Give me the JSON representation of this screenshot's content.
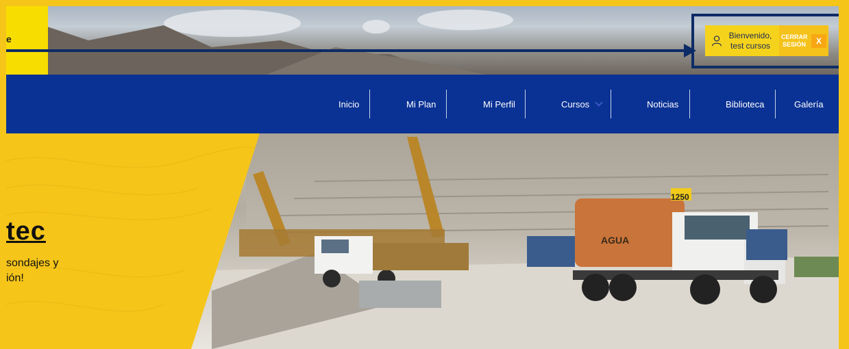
{
  "header": {
    "user_welcome_line1": "Bienvenido,",
    "user_welcome_line2": "test cursos",
    "logout_line1": "CERRAR",
    "logout_line2": "SESIÓN",
    "logout_x": "X",
    "logo_fragment": "e"
  },
  "nav": {
    "items": [
      {
        "label": "Inicio"
      },
      {
        "label": "Mi Plan"
      },
      {
        "label": "Mi Perfil"
      },
      {
        "label": "Cursos"
      },
      {
        "label": "Noticias"
      },
      {
        "label": "Biblioteca"
      },
      {
        "label": "Galería"
      }
    ]
  },
  "hero": {
    "title": "tec",
    "subtitle": "sondajes y\nión!"
  },
  "truck": {
    "tank_label": "AGUA",
    "number": "1250"
  },
  "colors": {
    "brand_yellow": "#f5c51a",
    "nav_blue": "#0a3294",
    "annotation_navy": "#0d2b66"
  }
}
